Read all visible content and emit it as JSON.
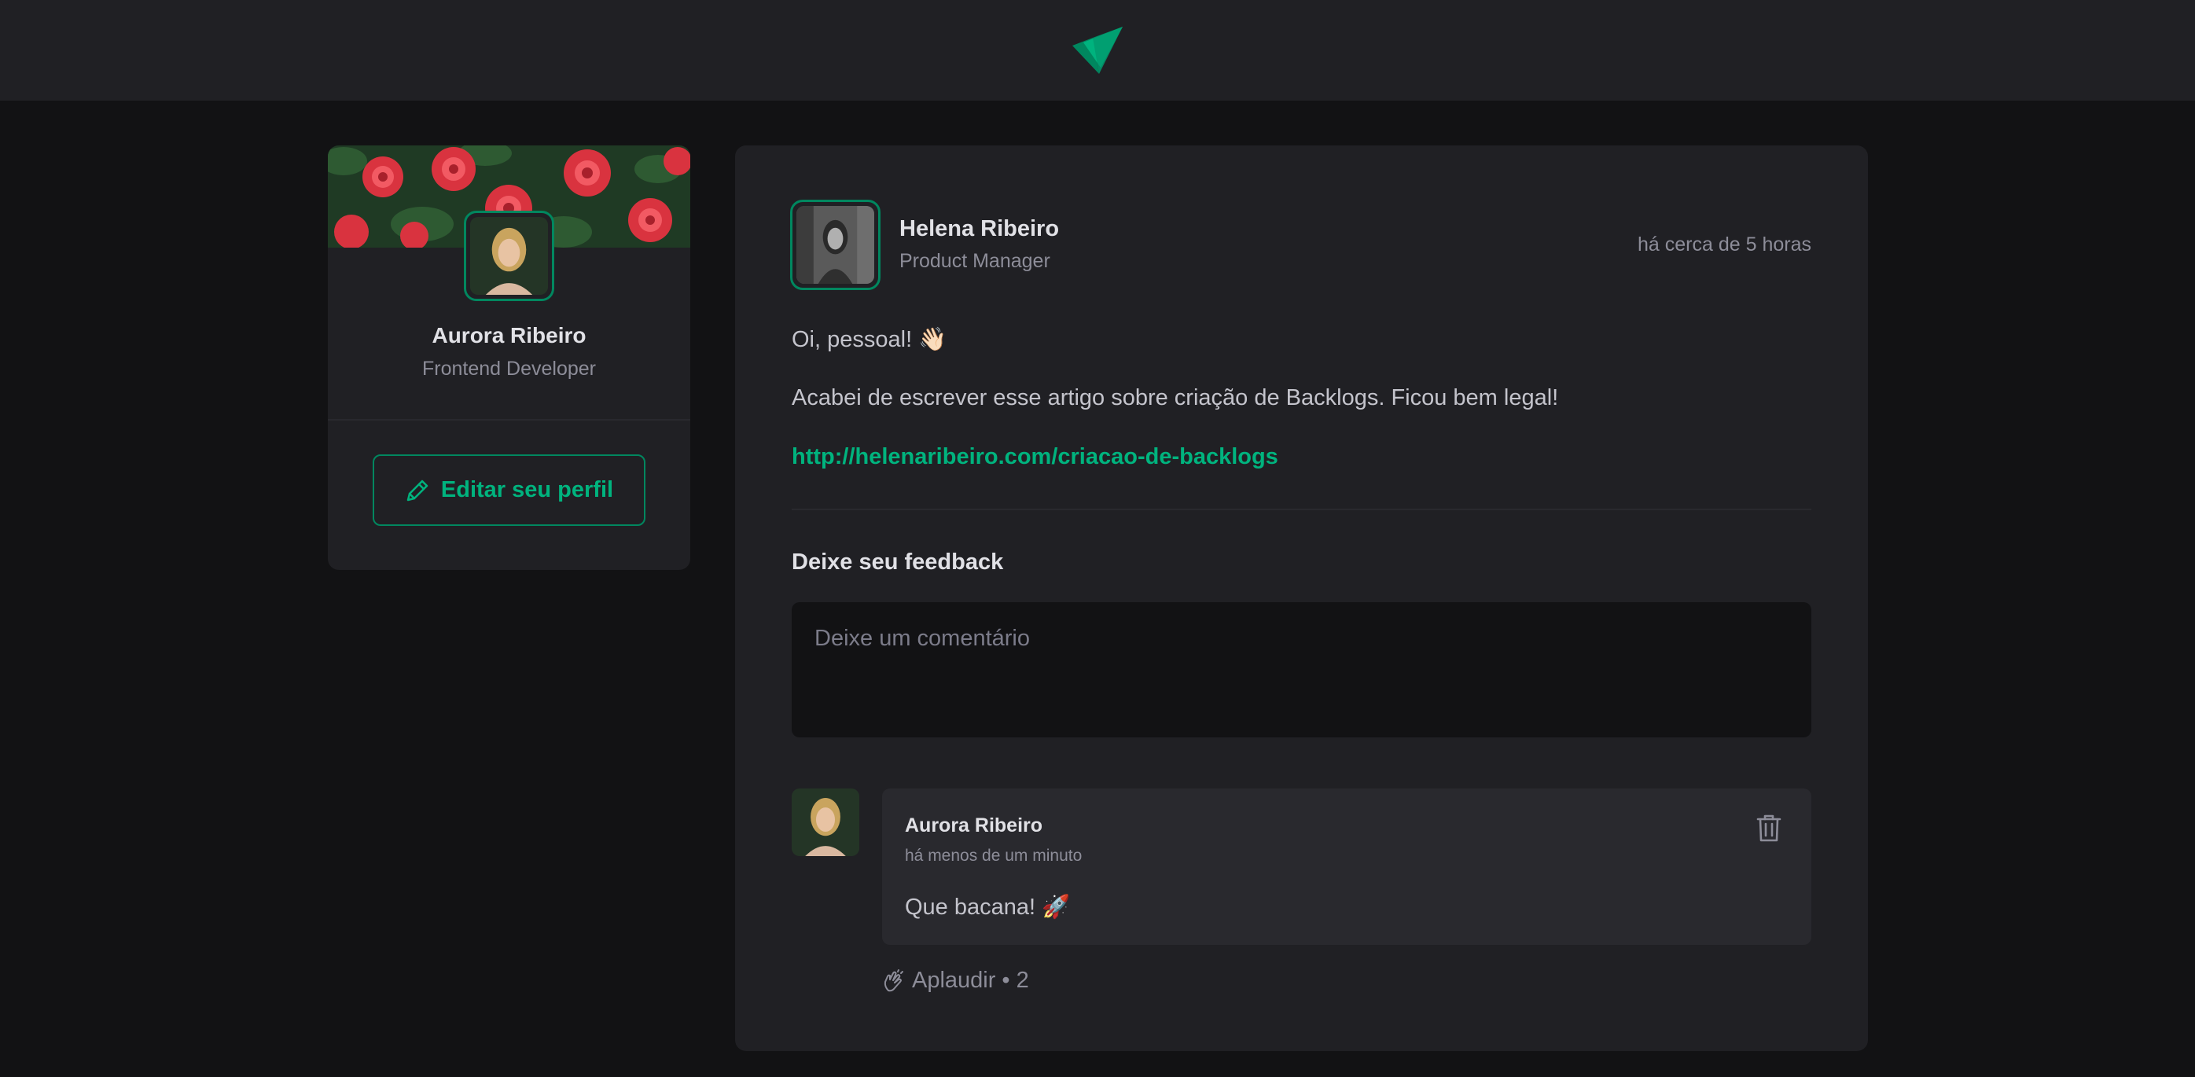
{
  "header": {
    "logo_icon": "ignite-feed-logo-icon"
  },
  "sidebar": {
    "name": "Aurora Ribeiro",
    "role": "Frontend Developer",
    "edit_label": "Editar seu perfil"
  },
  "post": {
    "author": {
      "name": "Helena Ribeiro",
      "role": "Product Manager"
    },
    "time": "há cerca de 5 horas",
    "content": {
      "greeting": "Oi, pessoal! 👋🏻",
      "body": "Acabei de escrever esse artigo sobre criação de Backlogs. Ficou bem legal!",
      "link": "http://helenaribeiro.com/criacao-de-backlogs"
    },
    "feedback": {
      "title": "Deixe seu feedback",
      "placeholder": "Deixe um comentário"
    },
    "comment": {
      "author": "Aurora Ribeiro",
      "time": "há menos de um minuto",
      "text": "Que bacana! 🚀",
      "applaud_label": "Aplaudir",
      "applaud_separator": "•",
      "applaud_count": "2"
    }
  },
  "colors": {
    "background": "#121214",
    "surface": "#202024",
    "comment_surface": "#29292e",
    "brand": "#00875f",
    "brand_light": "#00b37e"
  }
}
